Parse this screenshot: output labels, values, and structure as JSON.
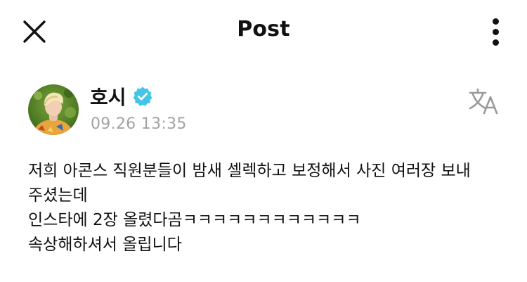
{
  "header": {
    "title": "Post",
    "close_icon": "close-icon",
    "more_icon": "more-vertical-icon"
  },
  "author": {
    "name": "호시",
    "verified_icon": "verified-badge-icon",
    "timestamp": "09.26 13:35",
    "translate_icon": "translate-icon"
  },
  "post": {
    "lines": [
      "저희 아콘스 직원분들이 밤새 셀렉하고 보정해서 사진 여러장 보내",
      "주셨는데",
      "인스타에 2장 올렸다곰ㅋㅋㅋㅋㅋㅋㅋㅋㅋㅋㅋㅋ",
      "속상해하셔서 올립니다"
    ]
  },
  "colors": {
    "text": "#111111",
    "timestamp": "#a3a3a3",
    "verified": "#42c5e6",
    "icon_gray": "#9a9a9a"
  }
}
